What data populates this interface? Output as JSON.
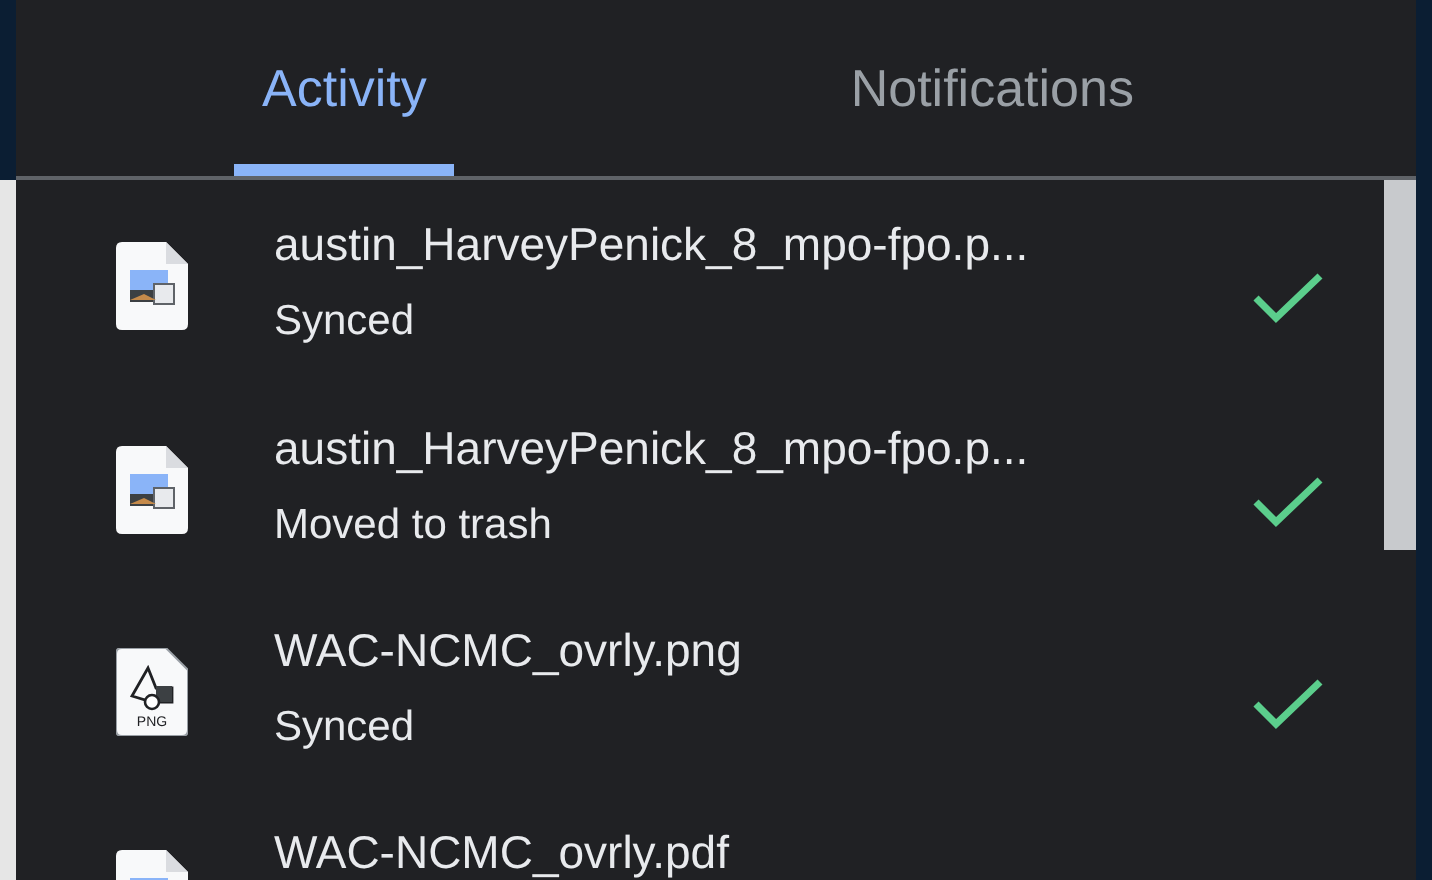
{
  "tabs": [
    {
      "label": "Activity",
      "selected": true
    },
    {
      "label": "Notifications",
      "selected": false
    }
  ],
  "activity": [
    {
      "kind": "image",
      "name": "austin_HarveyPenick_8_mpo-fpo.p...",
      "status": "Synced",
      "done": true
    },
    {
      "kind": "image",
      "name": "austin_HarveyPenick_8_mpo-fpo.p...",
      "status": "Moved to trash",
      "done": true
    },
    {
      "kind": "png",
      "icon_label": "PNG",
      "name": "WAC-NCMC_ovrly.png",
      "status": "Synced",
      "done": true
    },
    {
      "kind": "image",
      "name": "WAC-NCMC_ovrly.pdf"
    }
  ]
}
